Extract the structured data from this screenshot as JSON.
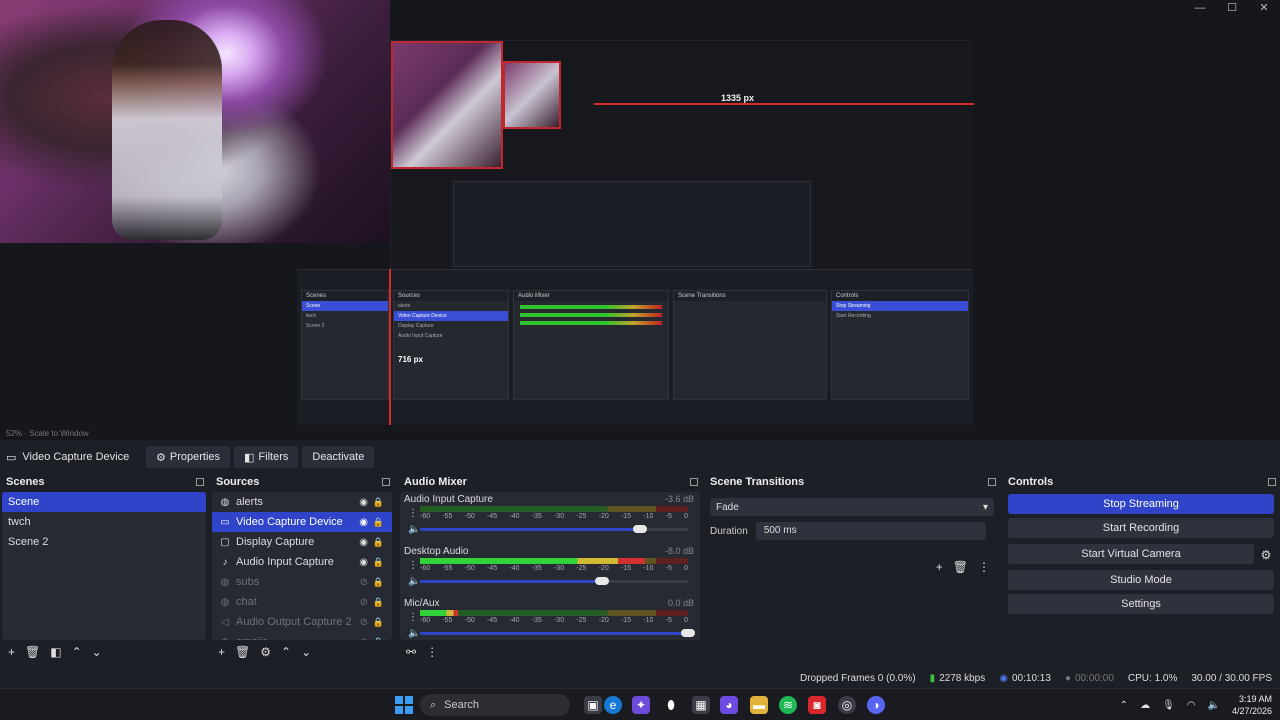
{
  "window": {
    "minimize": "—",
    "maximize": "☐",
    "close": "✕"
  },
  "preview": {
    "measure_label": "1335 px",
    "nested_label": "716 px",
    "scale_text": "52%  ·  Scale to Window"
  },
  "source_toolbar": {
    "selected_source": "Video Capture Device",
    "properties_label": "Properties",
    "filters_label": "Filters",
    "deactivate_label": "Deactivate"
  },
  "scenes": {
    "title": "Scenes",
    "items": [
      "Scene",
      "twch",
      "Scene 2"
    ],
    "selected_index": 0
  },
  "sources": {
    "title": "Sources",
    "items": [
      {
        "label": "alerts",
        "icon": "browser-icon",
        "visible": true
      },
      {
        "label": "Video Capture Device",
        "icon": "camera-icon",
        "visible": true,
        "selected": true
      },
      {
        "label": "Display Capture",
        "icon": "monitor-icon",
        "visible": true
      },
      {
        "label": "Audio Input Capture",
        "icon": "mic-icon",
        "visible": true
      },
      {
        "label": "subs",
        "icon": "browser-icon",
        "visible": false
      },
      {
        "label": "chat",
        "icon": "browser-icon",
        "visible": false
      },
      {
        "label": "Audio Output Capture 2",
        "icon": "speaker-icon",
        "visible": false
      },
      {
        "label": "emojis",
        "icon": "browser-icon",
        "visible": false
      }
    ]
  },
  "audio_mixer": {
    "title": "Audio Mixer",
    "ticks": [
      "-60",
      "-55",
      "-50",
      "-45",
      "-40",
      "-35",
      "-30",
      "-25",
      "-20",
      "-15",
      "-10",
      "-5",
      "0"
    ],
    "channels": [
      {
        "name": "Audio Input Capture",
        "db": "-3.6 dB",
        "level": 0.0,
        "volume": 0.82
      },
      {
        "name": "Desktop Audio",
        "db": "-8.0 dB",
        "level": 0.84,
        "volume": 0.68
      },
      {
        "name": "Mic/Aux",
        "db": "0.0 dB",
        "level": 0.14,
        "volume": 1.0
      }
    ]
  },
  "transitions": {
    "title": "Scene Transitions",
    "selected": "Fade",
    "duration_label": "Duration",
    "duration_value": "500 ms"
  },
  "controls": {
    "title": "Controls",
    "stop_streaming": "Stop Streaming",
    "start_recording": "Start Recording",
    "start_virtual_camera": "Start Virtual Camera",
    "studio_mode": "Studio Mode",
    "settings": "Settings"
  },
  "status": {
    "dropped_frames": "Dropped Frames 0 (0.0%)",
    "bitrate": "2278 kbps",
    "stream_time": "00:10:13",
    "record_time": "00:00:00",
    "cpu": "CPU: 1.0%",
    "fps": "30.00 / 30.00 FPS"
  },
  "taskbar": {
    "search_placeholder": "Search",
    "time": "3:19 AM",
    "date": "4/27/2026"
  },
  "colors": {
    "accent": "#2f44c8",
    "panel": "#272a33",
    "background": "#1d1f26"
  }
}
